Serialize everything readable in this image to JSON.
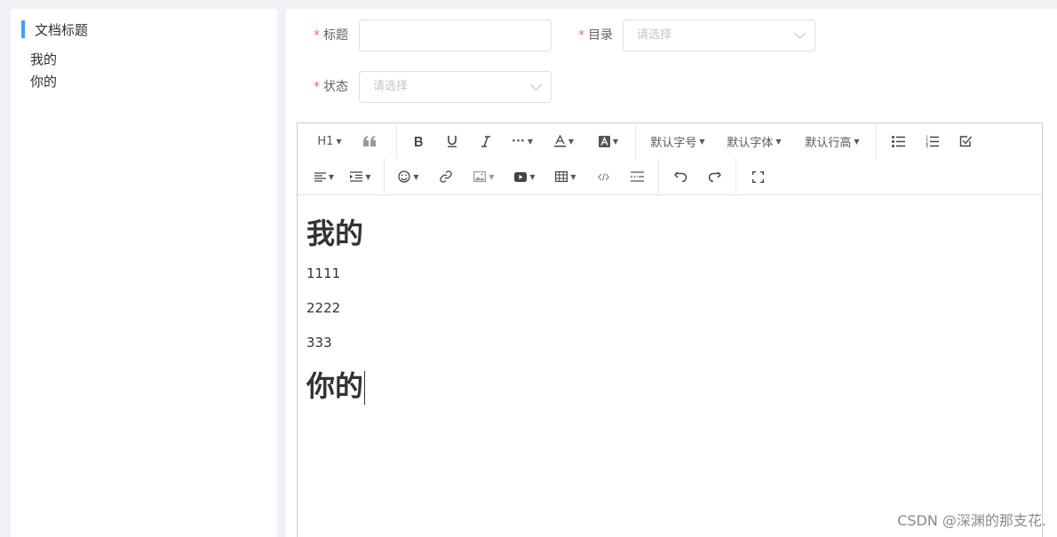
{
  "sidebar": {
    "title": "文档标题",
    "accent_color": "#409eff",
    "items": [
      {
        "label": "我的"
      },
      {
        "label": "你的"
      }
    ]
  },
  "form": {
    "title_label": "标题",
    "title_value": "",
    "catalog_label": "目录",
    "catalog_placeholder": "请选择",
    "status_label": "状态",
    "status_placeholder": "请选择",
    "required_mark": "*",
    "required_color": "#f56c6c"
  },
  "toolbar": {
    "heading": "H1",
    "font_size": "默认字号",
    "font_family": "默认字体",
    "line_height": "默认行高",
    "more": "···"
  },
  "content": {
    "heading1": "我的",
    "lines": [
      "1111",
      "2222",
      "333"
    ],
    "heading2": "你的"
  },
  "watermark": "CSDN @深渊的那支花."
}
